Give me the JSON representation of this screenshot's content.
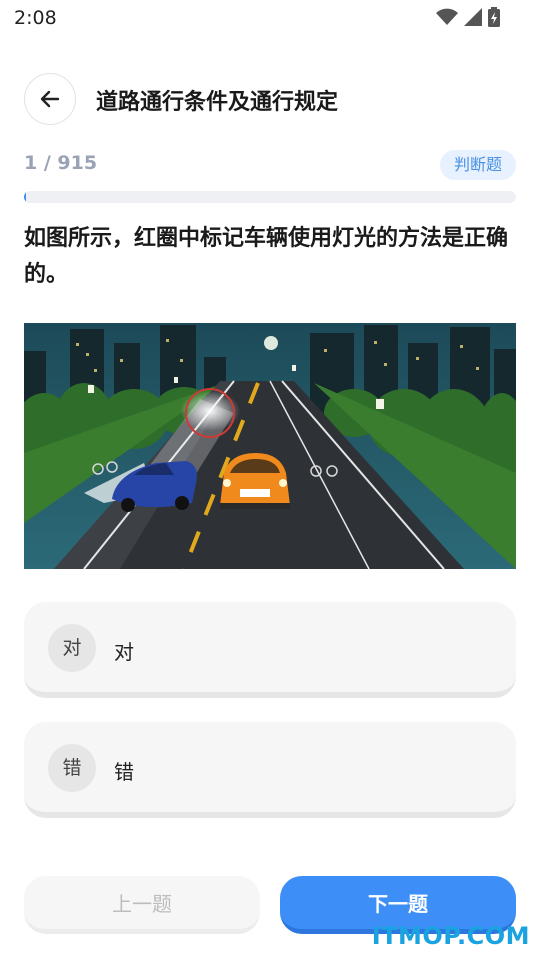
{
  "status": {
    "time": "2:08"
  },
  "header": {
    "title": "道路通行条件及通行规定"
  },
  "progress": {
    "text": "1 / 915",
    "current": 1,
    "total": 915,
    "fraction": 0.0011
  },
  "question": {
    "type_badge": "判断题",
    "text": "如图所示，红圈中标记车辆使用灯光的方法是正确的。"
  },
  "options": [
    {
      "badge": "对",
      "label": "对"
    },
    {
      "badge": "错",
      "label": "错"
    }
  ],
  "nav": {
    "prev_label": "上一题",
    "next_label": "下一题"
  },
  "watermark": {
    "text": "ITMOP.COM"
  },
  "colors": {
    "accent": "#3d8ff7",
    "badge_bg": "#e7f1ff",
    "muted": "#9aa3b5",
    "watermark": "#1aa3e0"
  }
}
